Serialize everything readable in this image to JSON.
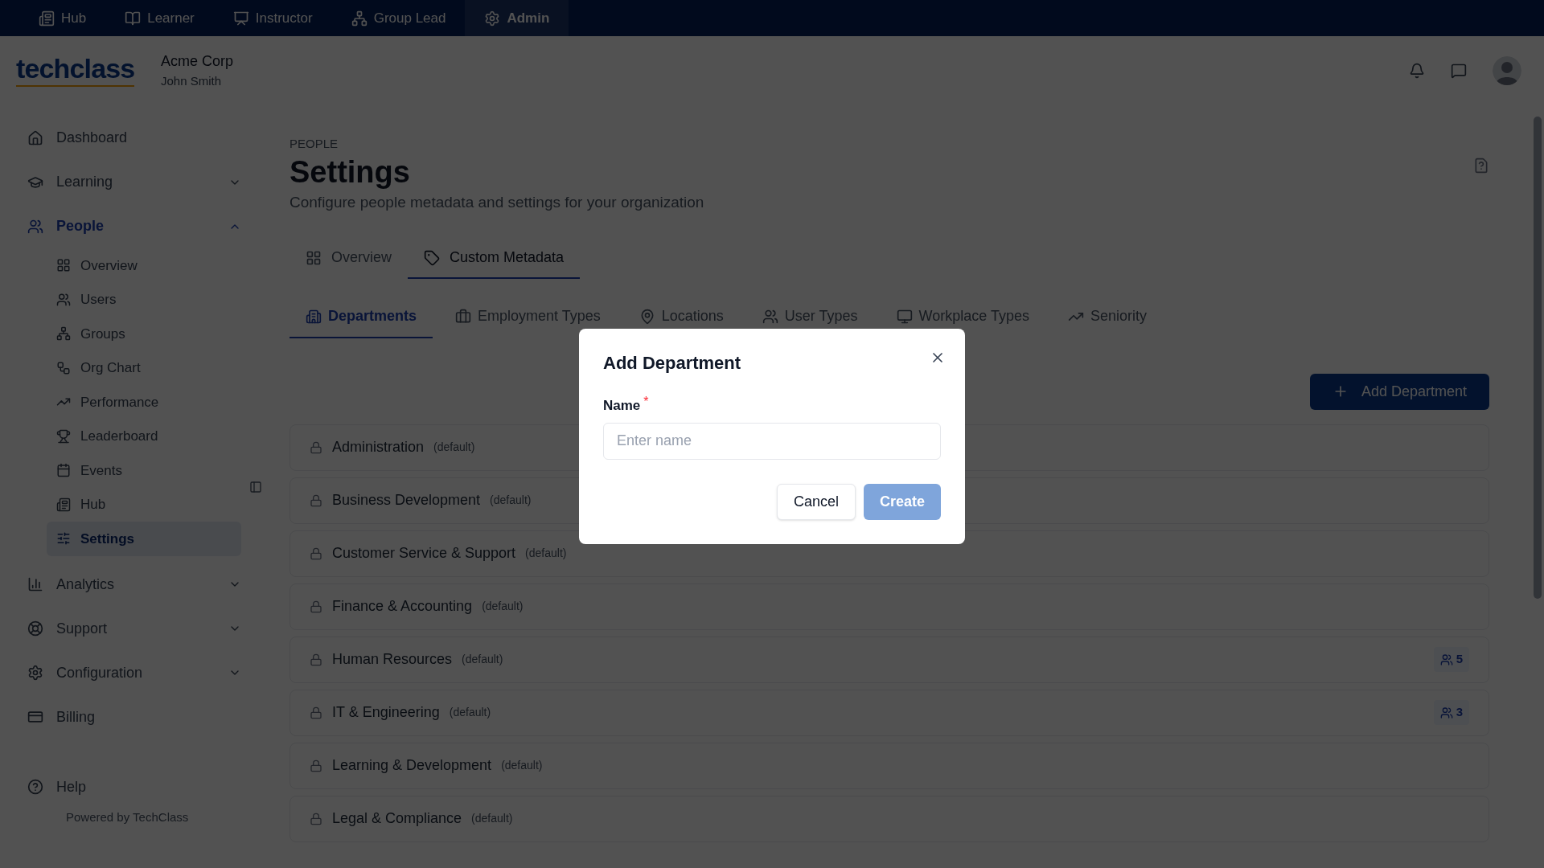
{
  "top_nav": [
    {
      "label": "Hub",
      "selected": false
    },
    {
      "label": "Learner",
      "selected": false
    },
    {
      "label": "Instructor",
      "selected": false
    },
    {
      "label": "Group Lead",
      "selected": false
    },
    {
      "label": "Admin",
      "selected": true
    }
  ],
  "header": {
    "logo": "techclass",
    "org": "Acme Corp",
    "user": "John Smith"
  },
  "sidebar": {
    "items": [
      {
        "label": "Dashboard",
        "selected": false
      },
      {
        "label": "Learning",
        "selected": false,
        "expanded": false
      },
      {
        "label": "People",
        "selected": true,
        "expanded": true,
        "children": [
          {
            "label": "Overview",
            "selected": false
          },
          {
            "label": "Users",
            "selected": false
          },
          {
            "label": "Groups",
            "selected": false
          },
          {
            "label": "Org Chart",
            "selected": false
          },
          {
            "label": "Performance",
            "selected": false
          },
          {
            "label": "Leaderboard",
            "selected": false
          },
          {
            "label": "Events",
            "selected": false
          },
          {
            "label": "Hub",
            "selected": false
          },
          {
            "label": "Settings",
            "selected": true
          }
        ]
      },
      {
        "label": "Analytics",
        "selected": false,
        "expanded": false
      },
      {
        "label": "Support",
        "selected": false,
        "expanded": false
      },
      {
        "label": "Configuration",
        "selected": false,
        "expanded": false
      },
      {
        "label": "Billing",
        "selected": false
      }
    ],
    "help": "Help",
    "footer": "Powered by TechClass"
  },
  "page": {
    "breadcrumb": "PEOPLE",
    "title": "Settings",
    "subtitle": "Configure people metadata and settings for your organization"
  },
  "tabs": [
    {
      "label": "Overview",
      "selected": false
    },
    {
      "label": "Custom Metadata",
      "selected": true
    }
  ],
  "subtabs": [
    {
      "label": "Departments",
      "selected": true
    },
    {
      "label": "Employment Types",
      "selected": false
    },
    {
      "label": "Locations",
      "selected": false
    },
    {
      "label": "User Types",
      "selected": false
    },
    {
      "label": "Workplace Types",
      "selected": false
    },
    {
      "label": "Seniority",
      "selected": false
    }
  ],
  "add_button": "Add Department",
  "departments": [
    {
      "name": "Administration",
      "tag": "(default)"
    },
    {
      "name": "Business Development",
      "tag": "(default)"
    },
    {
      "name": "Customer Service & Support",
      "tag": "(default)"
    },
    {
      "name": "Finance & Accounting",
      "tag": "(default)"
    },
    {
      "name": "Human Resources",
      "tag": "(default)",
      "count": "5"
    },
    {
      "name": "IT & Engineering",
      "tag": "(default)",
      "count": "3"
    },
    {
      "name": "Learning & Development",
      "tag": "(default)"
    },
    {
      "name": "Legal & Compliance",
      "tag": "(default)"
    }
  ],
  "dialog": {
    "title": "Add Department",
    "field": {
      "label": "Name",
      "required_mark": "*",
      "placeholder": "Enter name"
    },
    "cancel": "Cancel",
    "create": {
      "label": "Create",
      "disabled": true
    }
  }
}
